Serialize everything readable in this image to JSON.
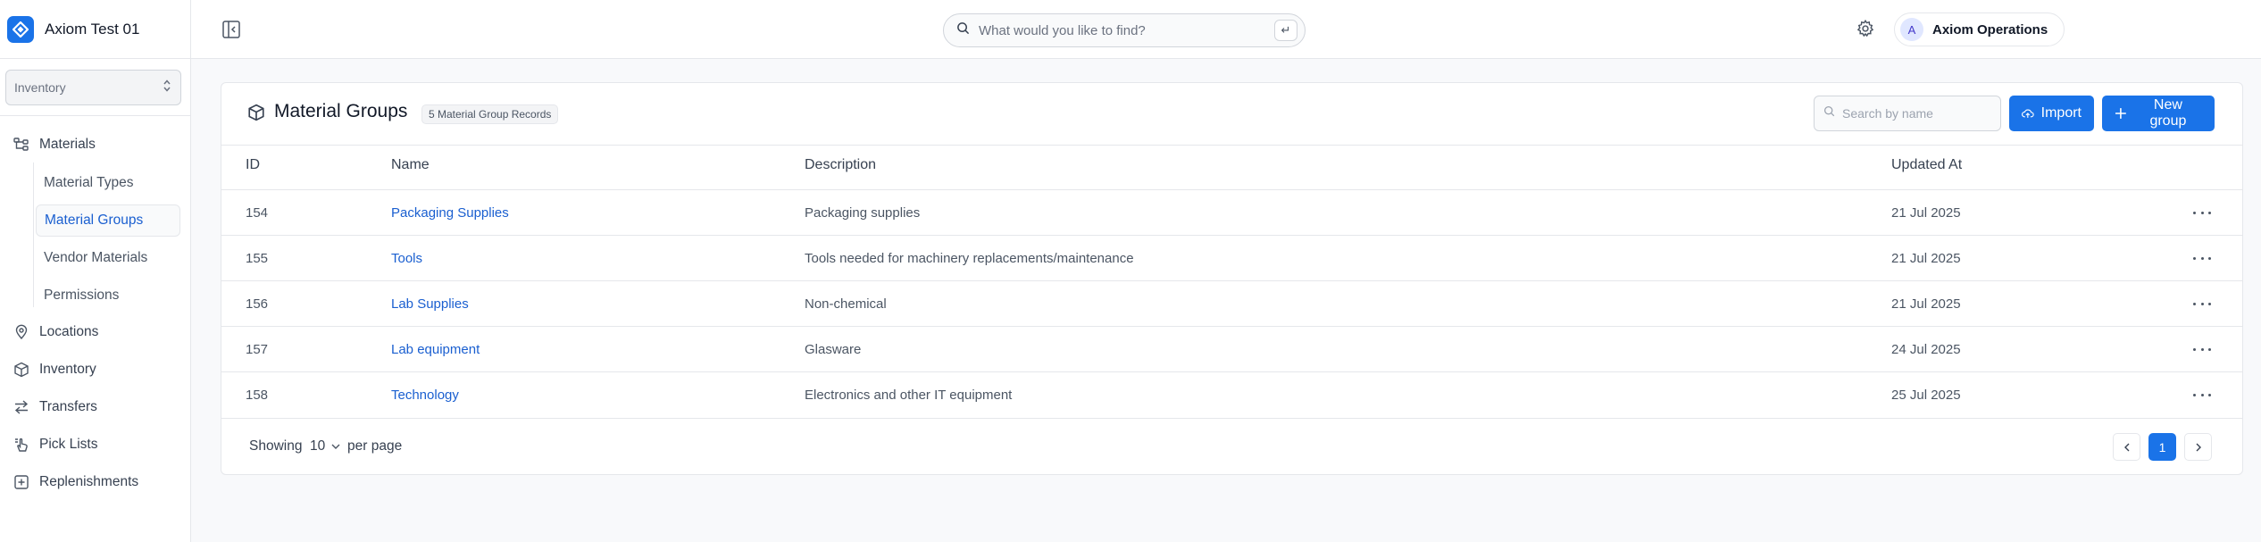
{
  "sidebar": {
    "brand_title": "Axiom Test 01",
    "workspace_select": "Inventory",
    "items": [
      {
        "label": "Materials",
        "icon": "hierarchy-icon"
      },
      {
        "label": "Locations",
        "icon": "map-pin-icon"
      },
      {
        "label": "Inventory",
        "icon": "box-icon"
      },
      {
        "label": "Transfers",
        "icon": "arrows-swap-icon"
      },
      {
        "label": "Pick Lists",
        "icon": "hand-pointer-icon"
      },
      {
        "label": "Replenishments",
        "icon": "add-box-icon"
      }
    ],
    "sub_items": [
      "Material Types",
      "Material Groups",
      "Vendor Materials",
      "Permissions"
    ],
    "active_sub_item": "Material Groups"
  },
  "topbar": {
    "search_placeholder": "What would you like to find?",
    "enter_key": "↵",
    "user_initial": "A",
    "user_name": "Axiom Operations"
  },
  "page": {
    "title": "Material Groups",
    "record_badge": "5 Material Group Records",
    "search_placeholder": "Search by name",
    "import_label": "Import",
    "new_label": "New group"
  },
  "table": {
    "columns": [
      "ID",
      "Name",
      "Description",
      "Updated At"
    ],
    "rows": [
      {
        "id": "154",
        "name": "Packaging Supplies",
        "description": "Packaging supplies",
        "updated": "21 Jul 2025"
      },
      {
        "id": "155",
        "name": "Tools",
        "description": "Tools needed for machinery replacements/maintenance",
        "updated": "21 Jul 2025"
      },
      {
        "id": "156",
        "name": "Lab Supplies",
        "description": "Non-chemical",
        "updated": "21 Jul 2025"
      },
      {
        "id": "157",
        "name": "Lab equipment",
        "description": "Glasware",
        "updated": "24 Jul 2025"
      },
      {
        "id": "158",
        "name": "Technology",
        "description": "Electronics and other IT equipment",
        "updated": "25 Jul 2025"
      }
    ]
  },
  "footer": {
    "showing_label": "Showing",
    "per_page_value": "10",
    "per_page_label": "per page",
    "current_page": "1"
  },
  "colors": {
    "accent": "#1a73e8",
    "link": "#1a5fd0",
    "border": "#e5e7eb"
  }
}
